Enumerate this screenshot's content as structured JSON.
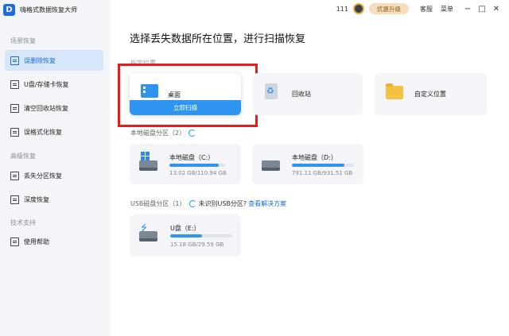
{
  "app": {
    "title": "嗨格式数据恢复大师",
    "logo_letter": "D"
  },
  "sidebar": {
    "sections": [
      {
        "label": "场景恢复",
        "items": [
          {
            "label": "误删除恢复",
            "active": true
          },
          {
            "label": "U盘/存储卡恢复",
            "active": false
          },
          {
            "label": "清空回收站恢复",
            "active": false
          },
          {
            "label": "误格式化恢复",
            "active": false
          }
        ]
      },
      {
        "label": "高级恢复",
        "items": [
          {
            "label": "丢失分区恢复",
            "active": false
          },
          {
            "label": "深度恢复",
            "active": false
          }
        ]
      },
      {
        "label": "技术支持",
        "items": [
          {
            "label": "使用帮助",
            "active": false
          }
        ]
      }
    ]
  },
  "topbar": {
    "coin_count": "111",
    "upgrade_label": "优惠升级",
    "service_label": "客服",
    "menu_label": "菜单",
    "minimize": "−",
    "maximize": "□",
    "close": "✕"
  },
  "main": {
    "heading": "选择丢失数据所在位置，进行扫描恢复",
    "locations_label": "指定位置",
    "locations": [
      {
        "label": "桌面",
        "scan_label": "立即扫描",
        "icon": "desktop-icon"
      },
      {
        "label": "回收站",
        "icon": "recycle-bin-icon"
      },
      {
        "label": "自定义位置",
        "icon": "folder-search-icon"
      }
    ],
    "local_group_label": "本地磁盘分区（2）",
    "local_disks": [
      {
        "name": "本地磁盘（C:）",
        "usage": "13.02 GB/110.94 GB",
        "used_fraction": 0.88
      },
      {
        "name": "本地磁盘（D:）",
        "usage": "791.11 GB/931.51 GB",
        "used_fraction": 0.85
      }
    ],
    "usb_group_label": "USB磁盘分区（1）",
    "usb_notice": "未识别USB分区?",
    "usb_link": "查看解决方案",
    "usb_disks": [
      {
        "name": "U盘（E:）",
        "usage": "15.18 GB/29.59 GB",
        "used_fraction": 0.51
      }
    ]
  },
  "colors": {
    "accent": "#2e96f2",
    "highlight_frame": "#e41d1d",
    "active_nav_bg": "#d6e6fb"
  }
}
